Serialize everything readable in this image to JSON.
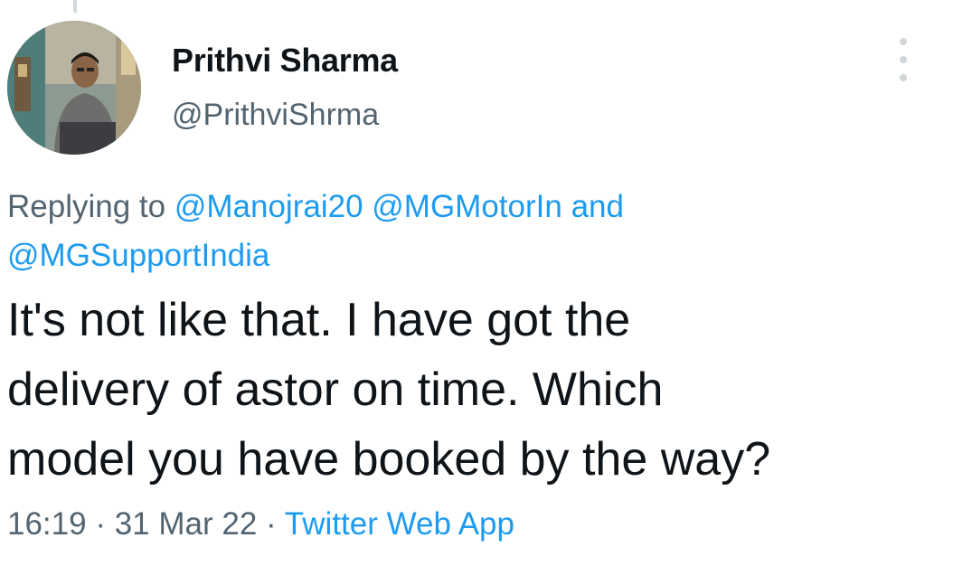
{
  "tweet": {
    "author": {
      "display_name": "Prithvi Sharma",
      "handle": "@PrithviShrma",
      "avatar_icon": "profile-photo"
    },
    "more_icon": "vertical-ellipsis-icon",
    "replying_to": {
      "prefix": "Replying to",
      "mentions": [
        "@Manojrai20",
        "@MGMotorIn"
      ],
      "conjunction": "and",
      "last_mention": "@MGSupportIndia"
    },
    "text": "It's not like that. I have got the\ndelivery of astor on time. Which\nmodel you have booked by the way?",
    "time": "16:19",
    "separator": "·",
    "date": "31 Mar 22",
    "source": "Twitter Web App"
  },
  "colors": {
    "link": "#1d9bf0",
    "secondary_text": "#536471",
    "primary_text": "#0f1419",
    "thread_line": "#cfd9de"
  }
}
